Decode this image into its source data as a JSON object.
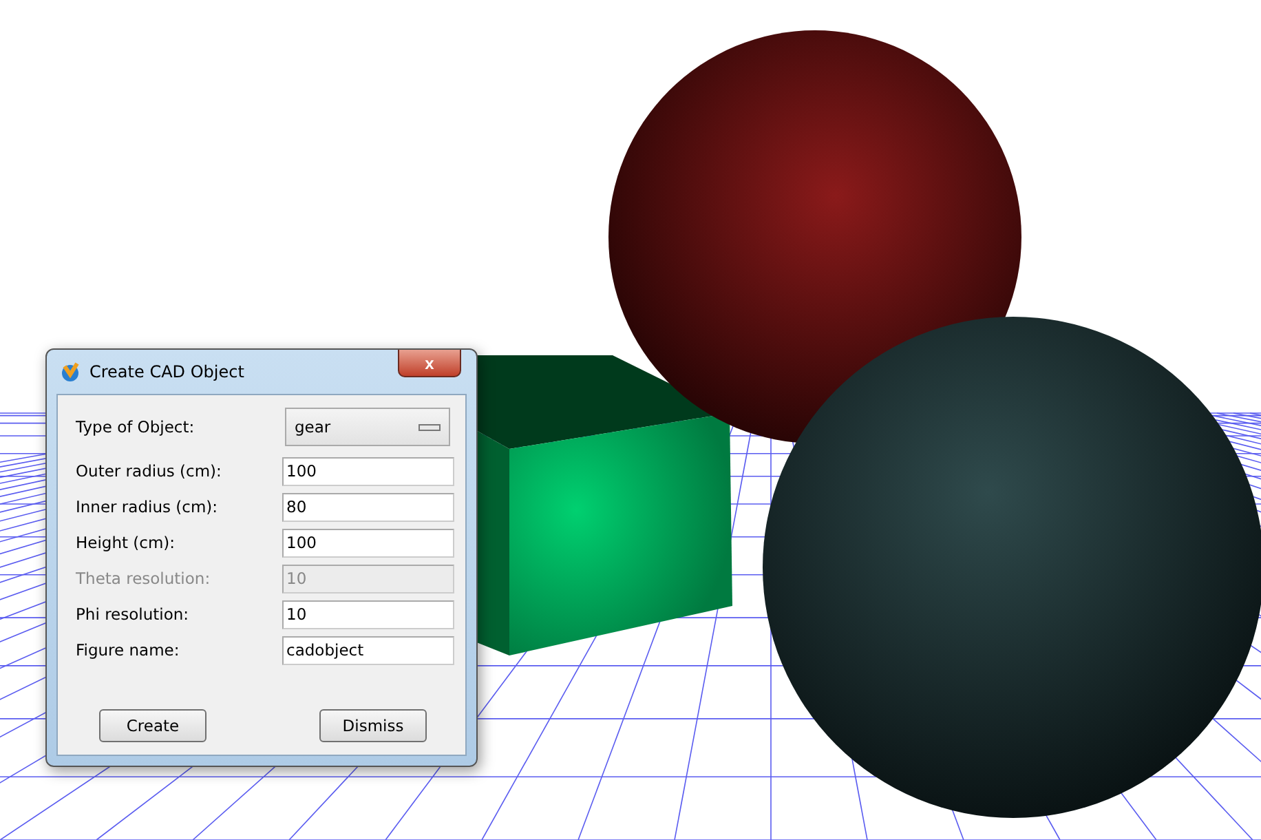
{
  "dialog": {
    "title": "Create CAD Object",
    "close_label": "x",
    "fields": [
      {
        "kind": "dropdown",
        "label": "Type of Object:",
        "value": "gear"
      },
      {
        "kind": "text",
        "label": "Outer radius (cm):",
        "value": "100",
        "disabled": false
      },
      {
        "kind": "text",
        "label": "Inner radius (cm):",
        "value": "80",
        "disabled": false
      },
      {
        "kind": "text",
        "label": "Height (cm):",
        "value": "100",
        "disabled": false
      },
      {
        "kind": "text",
        "label": "Theta resolution:",
        "value": "10",
        "disabled": true
      },
      {
        "kind": "text",
        "label": "Phi resolution:",
        "value": "10",
        "disabled": false
      },
      {
        "kind": "text",
        "label": "Figure name:",
        "value": "cadobject",
        "disabled": false
      }
    ],
    "buttons": [
      "Create",
      "Dismiss"
    ]
  }
}
